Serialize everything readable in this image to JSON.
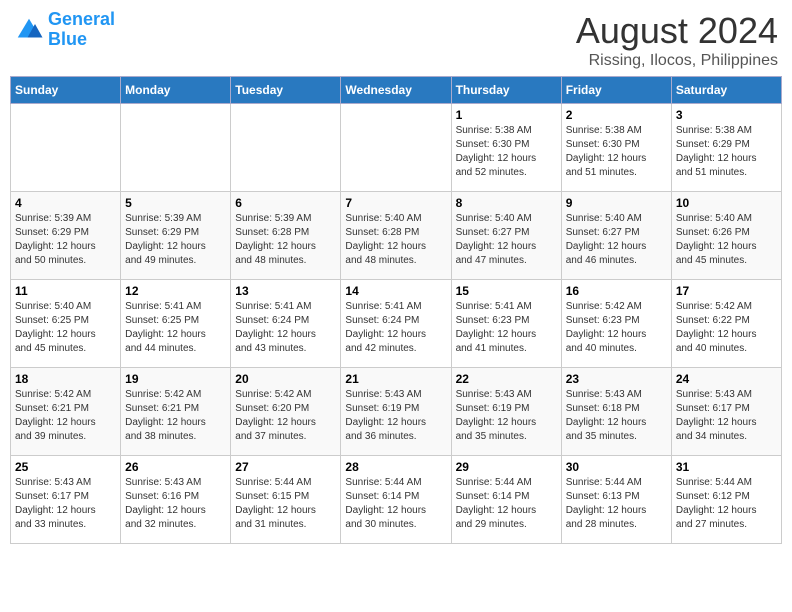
{
  "header": {
    "logo_line1": "General",
    "logo_line2": "Blue",
    "month_year": "August 2024",
    "location": "Rissing, Ilocos, Philippines"
  },
  "days_of_week": [
    "Sunday",
    "Monday",
    "Tuesday",
    "Wednesday",
    "Thursday",
    "Friday",
    "Saturday"
  ],
  "weeks": [
    [
      {
        "day": "",
        "info": ""
      },
      {
        "day": "",
        "info": ""
      },
      {
        "day": "",
        "info": ""
      },
      {
        "day": "",
        "info": ""
      },
      {
        "day": "1",
        "info": "Sunrise: 5:38 AM\nSunset: 6:30 PM\nDaylight: 12 hours\nand 52 minutes."
      },
      {
        "day": "2",
        "info": "Sunrise: 5:38 AM\nSunset: 6:30 PM\nDaylight: 12 hours\nand 51 minutes."
      },
      {
        "day": "3",
        "info": "Sunrise: 5:38 AM\nSunset: 6:29 PM\nDaylight: 12 hours\nand 51 minutes."
      }
    ],
    [
      {
        "day": "4",
        "info": "Sunrise: 5:39 AM\nSunset: 6:29 PM\nDaylight: 12 hours\nand 50 minutes."
      },
      {
        "day": "5",
        "info": "Sunrise: 5:39 AM\nSunset: 6:29 PM\nDaylight: 12 hours\nand 49 minutes."
      },
      {
        "day": "6",
        "info": "Sunrise: 5:39 AM\nSunset: 6:28 PM\nDaylight: 12 hours\nand 48 minutes."
      },
      {
        "day": "7",
        "info": "Sunrise: 5:40 AM\nSunset: 6:28 PM\nDaylight: 12 hours\nand 48 minutes."
      },
      {
        "day": "8",
        "info": "Sunrise: 5:40 AM\nSunset: 6:27 PM\nDaylight: 12 hours\nand 47 minutes."
      },
      {
        "day": "9",
        "info": "Sunrise: 5:40 AM\nSunset: 6:27 PM\nDaylight: 12 hours\nand 46 minutes."
      },
      {
        "day": "10",
        "info": "Sunrise: 5:40 AM\nSunset: 6:26 PM\nDaylight: 12 hours\nand 45 minutes."
      }
    ],
    [
      {
        "day": "11",
        "info": "Sunrise: 5:40 AM\nSunset: 6:25 PM\nDaylight: 12 hours\nand 45 minutes."
      },
      {
        "day": "12",
        "info": "Sunrise: 5:41 AM\nSunset: 6:25 PM\nDaylight: 12 hours\nand 44 minutes."
      },
      {
        "day": "13",
        "info": "Sunrise: 5:41 AM\nSunset: 6:24 PM\nDaylight: 12 hours\nand 43 minutes."
      },
      {
        "day": "14",
        "info": "Sunrise: 5:41 AM\nSunset: 6:24 PM\nDaylight: 12 hours\nand 42 minutes."
      },
      {
        "day": "15",
        "info": "Sunrise: 5:41 AM\nSunset: 6:23 PM\nDaylight: 12 hours\nand 41 minutes."
      },
      {
        "day": "16",
        "info": "Sunrise: 5:42 AM\nSunset: 6:23 PM\nDaylight: 12 hours\nand 40 minutes."
      },
      {
        "day": "17",
        "info": "Sunrise: 5:42 AM\nSunset: 6:22 PM\nDaylight: 12 hours\nand 40 minutes."
      }
    ],
    [
      {
        "day": "18",
        "info": "Sunrise: 5:42 AM\nSunset: 6:21 PM\nDaylight: 12 hours\nand 39 minutes."
      },
      {
        "day": "19",
        "info": "Sunrise: 5:42 AM\nSunset: 6:21 PM\nDaylight: 12 hours\nand 38 minutes."
      },
      {
        "day": "20",
        "info": "Sunrise: 5:42 AM\nSunset: 6:20 PM\nDaylight: 12 hours\nand 37 minutes."
      },
      {
        "day": "21",
        "info": "Sunrise: 5:43 AM\nSunset: 6:19 PM\nDaylight: 12 hours\nand 36 minutes."
      },
      {
        "day": "22",
        "info": "Sunrise: 5:43 AM\nSunset: 6:19 PM\nDaylight: 12 hours\nand 35 minutes."
      },
      {
        "day": "23",
        "info": "Sunrise: 5:43 AM\nSunset: 6:18 PM\nDaylight: 12 hours\nand 35 minutes."
      },
      {
        "day": "24",
        "info": "Sunrise: 5:43 AM\nSunset: 6:17 PM\nDaylight: 12 hours\nand 34 minutes."
      }
    ],
    [
      {
        "day": "25",
        "info": "Sunrise: 5:43 AM\nSunset: 6:17 PM\nDaylight: 12 hours\nand 33 minutes."
      },
      {
        "day": "26",
        "info": "Sunrise: 5:43 AM\nSunset: 6:16 PM\nDaylight: 12 hours\nand 32 minutes."
      },
      {
        "day": "27",
        "info": "Sunrise: 5:44 AM\nSunset: 6:15 PM\nDaylight: 12 hours\nand 31 minutes."
      },
      {
        "day": "28",
        "info": "Sunrise: 5:44 AM\nSunset: 6:14 PM\nDaylight: 12 hours\nand 30 minutes."
      },
      {
        "day": "29",
        "info": "Sunrise: 5:44 AM\nSunset: 6:14 PM\nDaylight: 12 hours\nand 29 minutes."
      },
      {
        "day": "30",
        "info": "Sunrise: 5:44 AM\nSunset: 6:13 PM\nDaylight: 12 hours\nand 28 minutes."
      },
      {
        "day": "31",
        "info": "Sunrise: 5:44 AM\nSunset: 6:12 PM\nDaylight: 12 hours\nand 27 minutes."
      }
    ]
  ]
}
